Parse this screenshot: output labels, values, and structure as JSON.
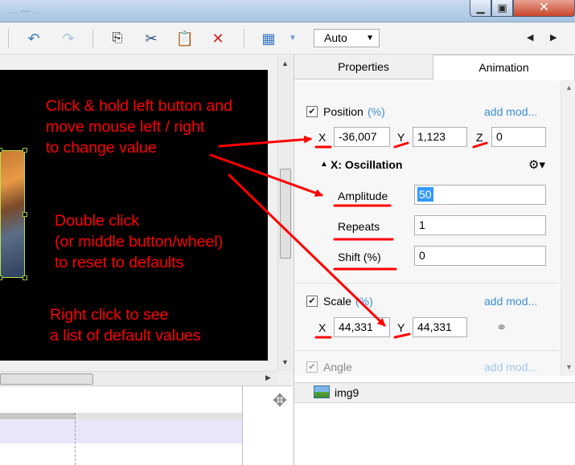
{
  "window": {
    "title_fragment": "... — ...",
    "min_icon": "minimize-icon",
    "max_icon": "maximize-icon",
    "close_icon": "close-icon"
  },
  "toolbar": {
    "icons": [
      "undo-icon",
      "redo-icon",
      "copy-icon",
      "cut-icon",
      "paste-icon",
      "delete-icon",
      "grid-icon"
    ],
    "zoom_value": "Auto"
  },
  "tabs": {
    "properties": "Properties",
    "animation": "Animation"
  },
  "position": {
    "label": "Position",
    "pct": "(%)",
    "add_mod": "add mod...",
    "x_label": "X",
    "x": "-36,007",
    "y_label": "Y",
    "y": "1,123",
    "z_label": "Z",
    "z": "0"
  },
  "oscillation": {
    "title": "X: Oscillation",
    "toggle": "▲",
    "amplitude_label": "Amplitude",
    "amplitude": "50",
    "repeats_label": "Repeats",
    "repeats": "1",
    "shift_label": "Shift (%)",
    "shift": "0"
  },
  "scale": {
    "label": "Scale",
    "pct": "(%)",
    "add_mod": "add mod...",
    "x_label": "X",
    "x": "44,331",
    "y_label": "Y",
    "y": "44,331"
  },
  "angle": {
    "label": "Angle",
    "add_mod": "add mod..."
  },
  "object": {
    "name": "img9"
  },
  "annotations": {
    "drag": [
      "Click & hold left button and",
      "move mouse left / right",
      "to change value"
    ],
    "reset": [
      "Double click",
      "(or middle button/wheel)",
      "to reset to defaults"
    ],
    "list": [
      "Right click to see",
      "a list of default values"
    ]
  },
  "colors": {
    "annotation": "#ff0000",
    "link": "#3b8fd6",
    "selection": "#3399ff"
  }
}
